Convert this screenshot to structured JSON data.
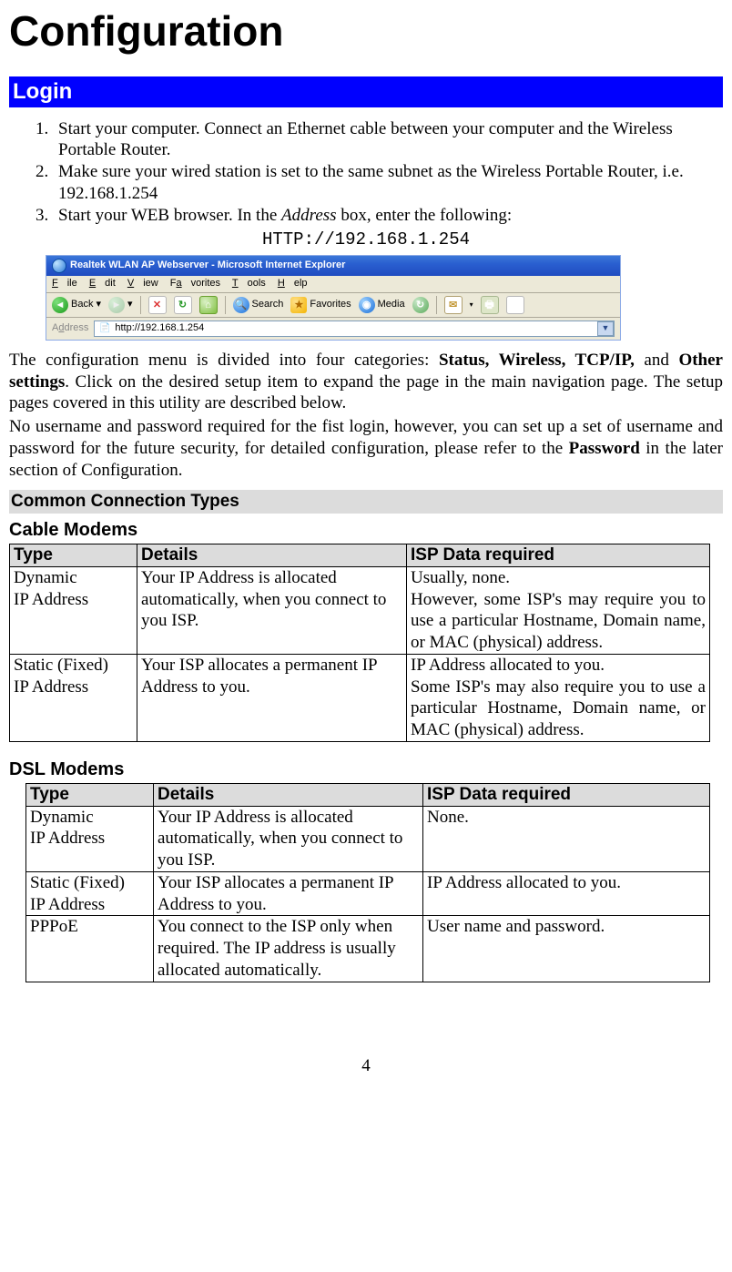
{
  "title": "Configuration",
  "login": {
    "heading": "Login",
    "steps": [
      "Start your computer. Connect an Ethernet cable between your computer and the Wireless Portable Router.",
      "Make sure your wired station is set to the same subnet as the Wireless Portable Router, i.e. 192.168.1.254",
      "Start your WEB browser. In the Address box, enter the following:"
    ],
    "step3_italic_word": "Address",
    "url": "HTTP://192.168.1.254"
  },
  "browser": {
    "title": "Realtek WLAN AP Webserver - Microsoft Internet Explorer",
    "menu": [
      "File",
      "Edit",
      "View",
      "Favorites",
      "Tools",
      "Help"
    ],
    "back": "Back",
    "search": "Search",
    "favorites": "Favorites",
    "media": "Media",
    "address_label": "Address",
    "address_value": "http://192.168.1.254"
  },
  "intro": {
    "p1a": "The configuration menu is divided into four categories: ",
    "p1b_bold": "Status, Wireless, TCP/IP,",
    "p1c": " and ",
    "p1d_bold": "Other settings",
    "p1e": ".  Click on the desired setup item to expand the page in the main navigation page. The setup pages covered in this utility are described below.",
    "p2a": "No username and password required for the fist login, however, you can set up a set of username and password for the future security, for detailed configuration, please refer to the ",
    "p2b_bold": "Password",
    "p2c": " in the later section of Configuration."
  },
  "cct_heading": "Common Connection Types",
  "cable": {
    "heading": "Cable Modems",
    "headers": [
      "Type",
      "Details",
      "ISP Data required"
    ],
    "rows": [
      {
        "type": "Dynamic IP Address",
        "details": "Your IP Address is allocated automatically, when you connect to you ISP.",
        "isp": "Usually, none.\nHowever, some ISP's may require you to use a particular Hostname, Domain name, or MAC (physical) address."
      },
      {
        "type": "Static (Fixed) IP Address",
        "details": "Your ISP allocates a permanent IP Address to you.",
        "isp": "IP Address allocated to you.\nSome ISP's may also require you to use a particular Hostname, Domain name, or MAC (physical) address."
      }
    ]
  },
  "dsl": {
    "heading": "DSL Modems",
    "headers": [
      "Type",
      "Details",
      "ISP Data required"
    ],
    "rows": [
      {
        "type": "Dynamic IP Address",
        "details": "Your IP Address is allocated automatically, when you connect to you ISP.",
        "isp": "None."
      },
      {
        "type": "Static (Fixed) IP Address",
        "details": "Your ISP allocates a permanent IP Address to you.",
        "isp": "IP Address allocated to you."
      },
      {
        "type": "PPPoE",
        "details": "You connect to the ISP only when required. The IP address is usually allocated automatically.",
        "isp": "User name and password."
      }
    ]
  },
  "page_number": "4"
}
